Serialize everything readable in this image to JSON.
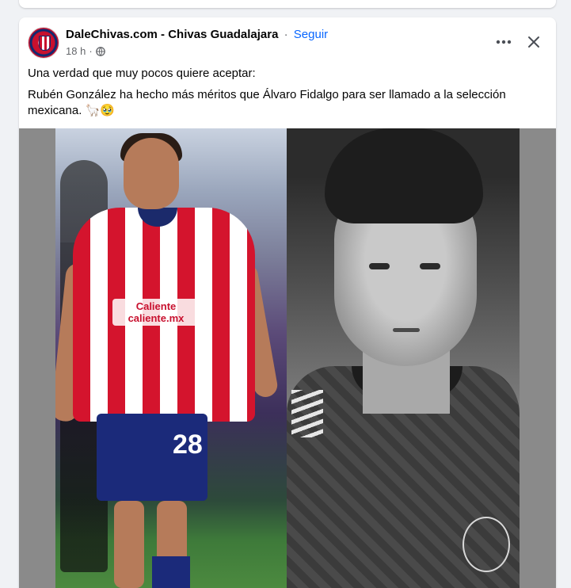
{
  "post": {
    "page_name": "DaleChivas.com - Chivas Guadalajara",
    "separator": "·",
    "follow_label": "Seguir",
    "time": "18 h",
    "meta_separator": "·",
    "text_line1": "Una verdad que muy pocos quiere aceptar:",
    "text_line2": "Rubén González ha hecho más méritos que Álvaro Fidalgo para ser llamado a la selección mexicana. 🦙🥹",
    "privacy_icon": "globe-icon",
    "menu_icon": "more-options-icon",
    "close_icon": "close-icon"
  },
  "media": {
    "left_photo": {
      "sponsor_text": "Caliente caliente.mx",
      "jersey_number": "28"
    }
  },
  "colors": {
    "background": "#f0f2f5",
    "link": "#0866ff",
    "text": "#050505",
    "secondary_text": "#65676b",
    "jersey_red": "#d4142d",
    "jersey_navy": "#1b2a6b"
  }
}
